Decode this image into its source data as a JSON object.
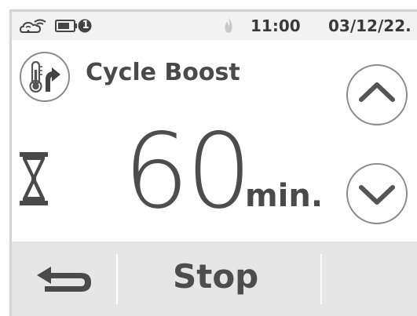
{
  "status_bar": {
    "wifi_icon": "wifi-cloud-icon",
    "battery_icon": "battery-icon",
    "battery_badge": "1",
    "flame_icon": "flame-icon",
    "time": "11:00",
    "date": "03/12/22."
  },
  "mode": {
    "icon": "thermometer-boost-icon",
    "label": "Cycle Boost"
  },
  "timer": {
    "icon": "hourglass-icon",
    "value": "60",
    "unit": "min."
  },
  "controls": {
    "increase_icon": "chevron-up-icon",
    "decrease_icon": "chevron-down-icon"
  },
  "bottom_bar": {
    "back_icon": "back-arrow-icon",
    "stop_label": "Stop"
  },
  "colors": {
    "statusbar_bg": "#f2f2f2",
    "bottombar_bg": "#e6e6e6",
    "text": "#4a4a4a",
    "icon_gray": "#888888"
  }
}
